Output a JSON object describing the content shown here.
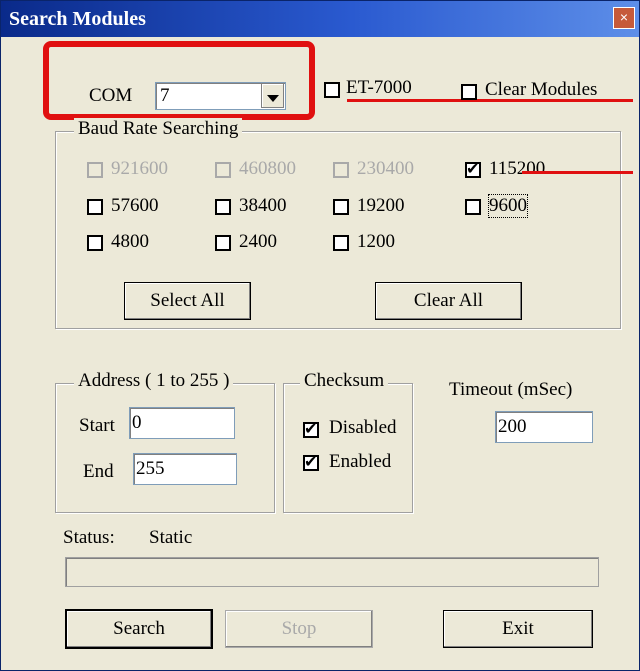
{
  "window": {
    "title": "Search Modules",
    "close_glyph": "×"
  },
  "com": {
    "label": "COM",
    "value": "7"
  },
  "options": {
    "et7000": "ET-7000",
    "clear_modules": "Clear Modules"
  },
  "baud": {
    "title": "Baud Rate Searching",
    "rates": [
      {
        "label": "921600",
        "checked": false,
        "disabled": true
      },
      {
        "label": "460800",
        "checked": false,
        "disabled": true
      },
      {
        "label": "230400",
        "checked": false,
        "disabled": true
      },
      {
        "label": "115200",
        "checked": true,
        "disabled": false
      },
      {
        "label": "57600",
        "checked": false,
        "disabled": false
      },
      {
        "label": "38400",
        "checked": false,
        "disabled": false
      },
      {
        "label": "19200",
        "checked": false,
        "disabled": false
      },
      {
        "label": "9600",
        "checked": false,
        "disabled": false
      },
      {
        "label": "4800",
        "checked": false,
        "disabled": false
      },
      {
        "label": "2400",
        "checked": false,
        "disabled": false
      },
      {
        "label": "1200",
        "checked": false,
        "disabled": false
      }
    ],
    "select_all": "Select All",
    "clear_all": "Clear All"
  },
  "address": {
    "title": "Address ( 1 to 255 )",
    "start_label": "Start",
    "start_value": "0",
    "end_label": "End",
    "end_value": "255"
  },
  "checksum": {
    "title": "Checksum",
    "disabled_label": "Disabled",
    "disabled_checked": true,
    "enabled_label": "Enabled",
    "enabled_checked": true
  },
  "timeout": {
    "label": "Timeout (mSec)",
    "value": "200"
  },
  "status": {
    "label": "Status:",
    "value": "Static",
    "progress": 0
  },
  "buttons": {
    "search": "Search",
    "stop": "Stop",
    "exit": "Exit"
  },
  "colors": {
    "annotation_red": "#e01010",
    "titlebar": "#0a246a",
    "face": "#ece9d8"
  }
}
